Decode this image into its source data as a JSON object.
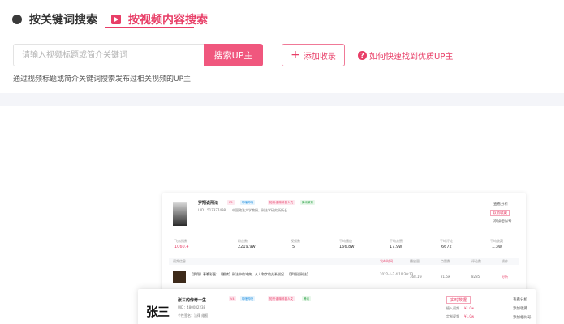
{
  "tabs": [
    {
      "label": "按关键词搜索"
    },
    {
      "label": "按视频内容搜索"
    }
  ],
  "search": {
    "placeholder": "请输入视频标题或简介关键词",
    "button_label": "搜索UP主"
  },
  "add_button": {
    "label": "添加收录"
  },
  "help_link": {
    "label": "如何快速找到优质UP主"
  },
  "hint": "通过视频标题或简介关键词搜索发布过相关视频的UP主",
  "preview": {
    "card1": {
      "name": "罗翔说刑法",
      "uid": "UID：517327498",
      "desc": "中国政法大学教授，刑法学研究所所长",
      "tags": [
        "V5",
        "哔哩哔哩",
        "知识·趣味科普人文",
        "腾讯教育"
      ],
      "stats_labels": [
        "飞瓜指数",
        "粉丝数",
        "视频数",
        "平均播放",
        "平均点赞",
        "平均评论",
        "平均收藏"
      ],
      "stats_values": [
        "1060.4",
        "2219.9w",
        "5",
        "166.8w",
        "17.9w",
        "6672",
        "1.3w"
      ],
      "side": [
        "查看分析",
        "取消收藏",
        "添加相似号"
      ],
      "list_header": [
        "视频信息",
        "发布时间",
        "播放量",
        "点赞数",
        "评论数",
        "操作"
      ],
      "video_title": "【罗翔】春晚彩蛋：【翻转】刑法中的冲突，从人和字的关系说起…【罗翔说刑法】",
      "video_date": "2022-1-2 4 10:30:13",
      "video_stats": [
        "368.1w",
        "21.5w",
        "8285"
      ],
      "video_action": "分析"
    },
    "card2": {
      "name": "张三的传奇一生",
      "avatar_text": "张三",
      "uid": "UID：480082238",
      "desc": "个性签名：法律 维权",
      "tags": [
        "V4",
        "哔哩哔哩",
        "知识·趣味科普人文",
        "腾讯"
      ],
      "live_label": "实时数据",
      "income_label": "植入视频",
      "income_value": "¥1.0w",
      "custom_label": "定制视频",
      "custom_value": "¥1.0w",
      "side": [
        "查看分析",
        "添加收藏",
        "添加相似号"
      ]
    }
  }
}
